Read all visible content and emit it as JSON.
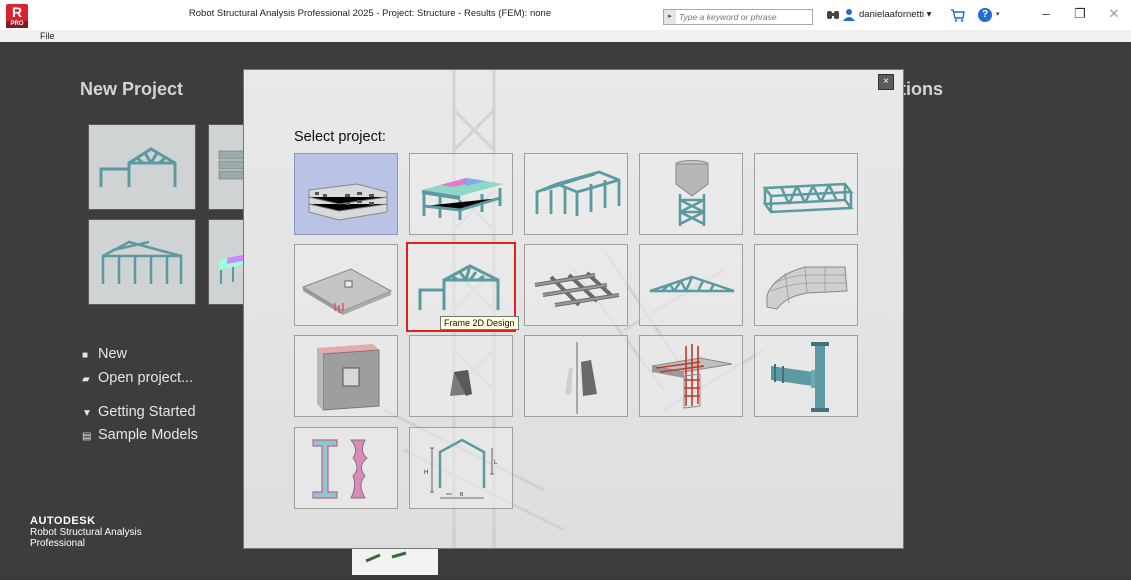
{
  "titlebar": {
    "app_logo": "R",
    "app_logo_badge": "PRO",
    "title": "Robot Structural Analysis Professional 2025 - Project: Structure - Results (FEM): none",
    "search_placeholder": "Type a keyword or phrase",
    "username": "danielaafornetti",
    "minimize": "–",
    "restore": "❐",
    "close": "✕"
  },
  "menu": {
    "file": "File"
  },
  "backstage": {
    "new_project": "New Project",
    "options_partial": "tions",
    "links": {
      "new": "New",
      "open": "Open project...",
      "getting_started": "Getting Started",
      "sample_models": "Sample Models"
    },
    "brand": {
      "company": "AUTODESK",
      "line1": "Robot Structural Analysis",
      "line2": "Professional"
    }
  },
  "dialog": {
    "title": "Select project:",
    "close": "×",
    "tooltip": "Frame 2D Design",
    "tiles": [
      {
        "icon": "building-3d-icon"
      },
      {
        "icon": "shell-building-icon"
      },
      {
        "icon": "frame-3d-icon"
      },
      {
        "icon": "silo-icon"
      },
      {
        "icon": "truss-3d-icon"
      },
      {
        "icon": "plate-icon"
      },
      {
        "icon": "frame-2d-icon"
      },
      {
        "icon": "grillage-icon"
      },
      {
        "icon": "truss-2d-icon"
      },
      {
        "icon": "shell-icon"
      },
      {
        "icon": "wall-icon"
      },
      {
        "icon": "volumetric-icon"
      },
      {
        "icon": "axisymmetric-icon"
      },
      {
        "icon": "rc-beam-icon"
      },
      {
        "icon": "steel-connection-icon"
      },
      {
        "icon": "section-definition-icon"
      },
      {
        "icon": "portal-frame-icon"
      }
    ],
    "colors": {
      "member": "#5b9aa0",
      "member_dark": "#3e7479",
      "selected_bg": "#b8c3e6",
      "highlight": "#e02020"
    }
  }
}
